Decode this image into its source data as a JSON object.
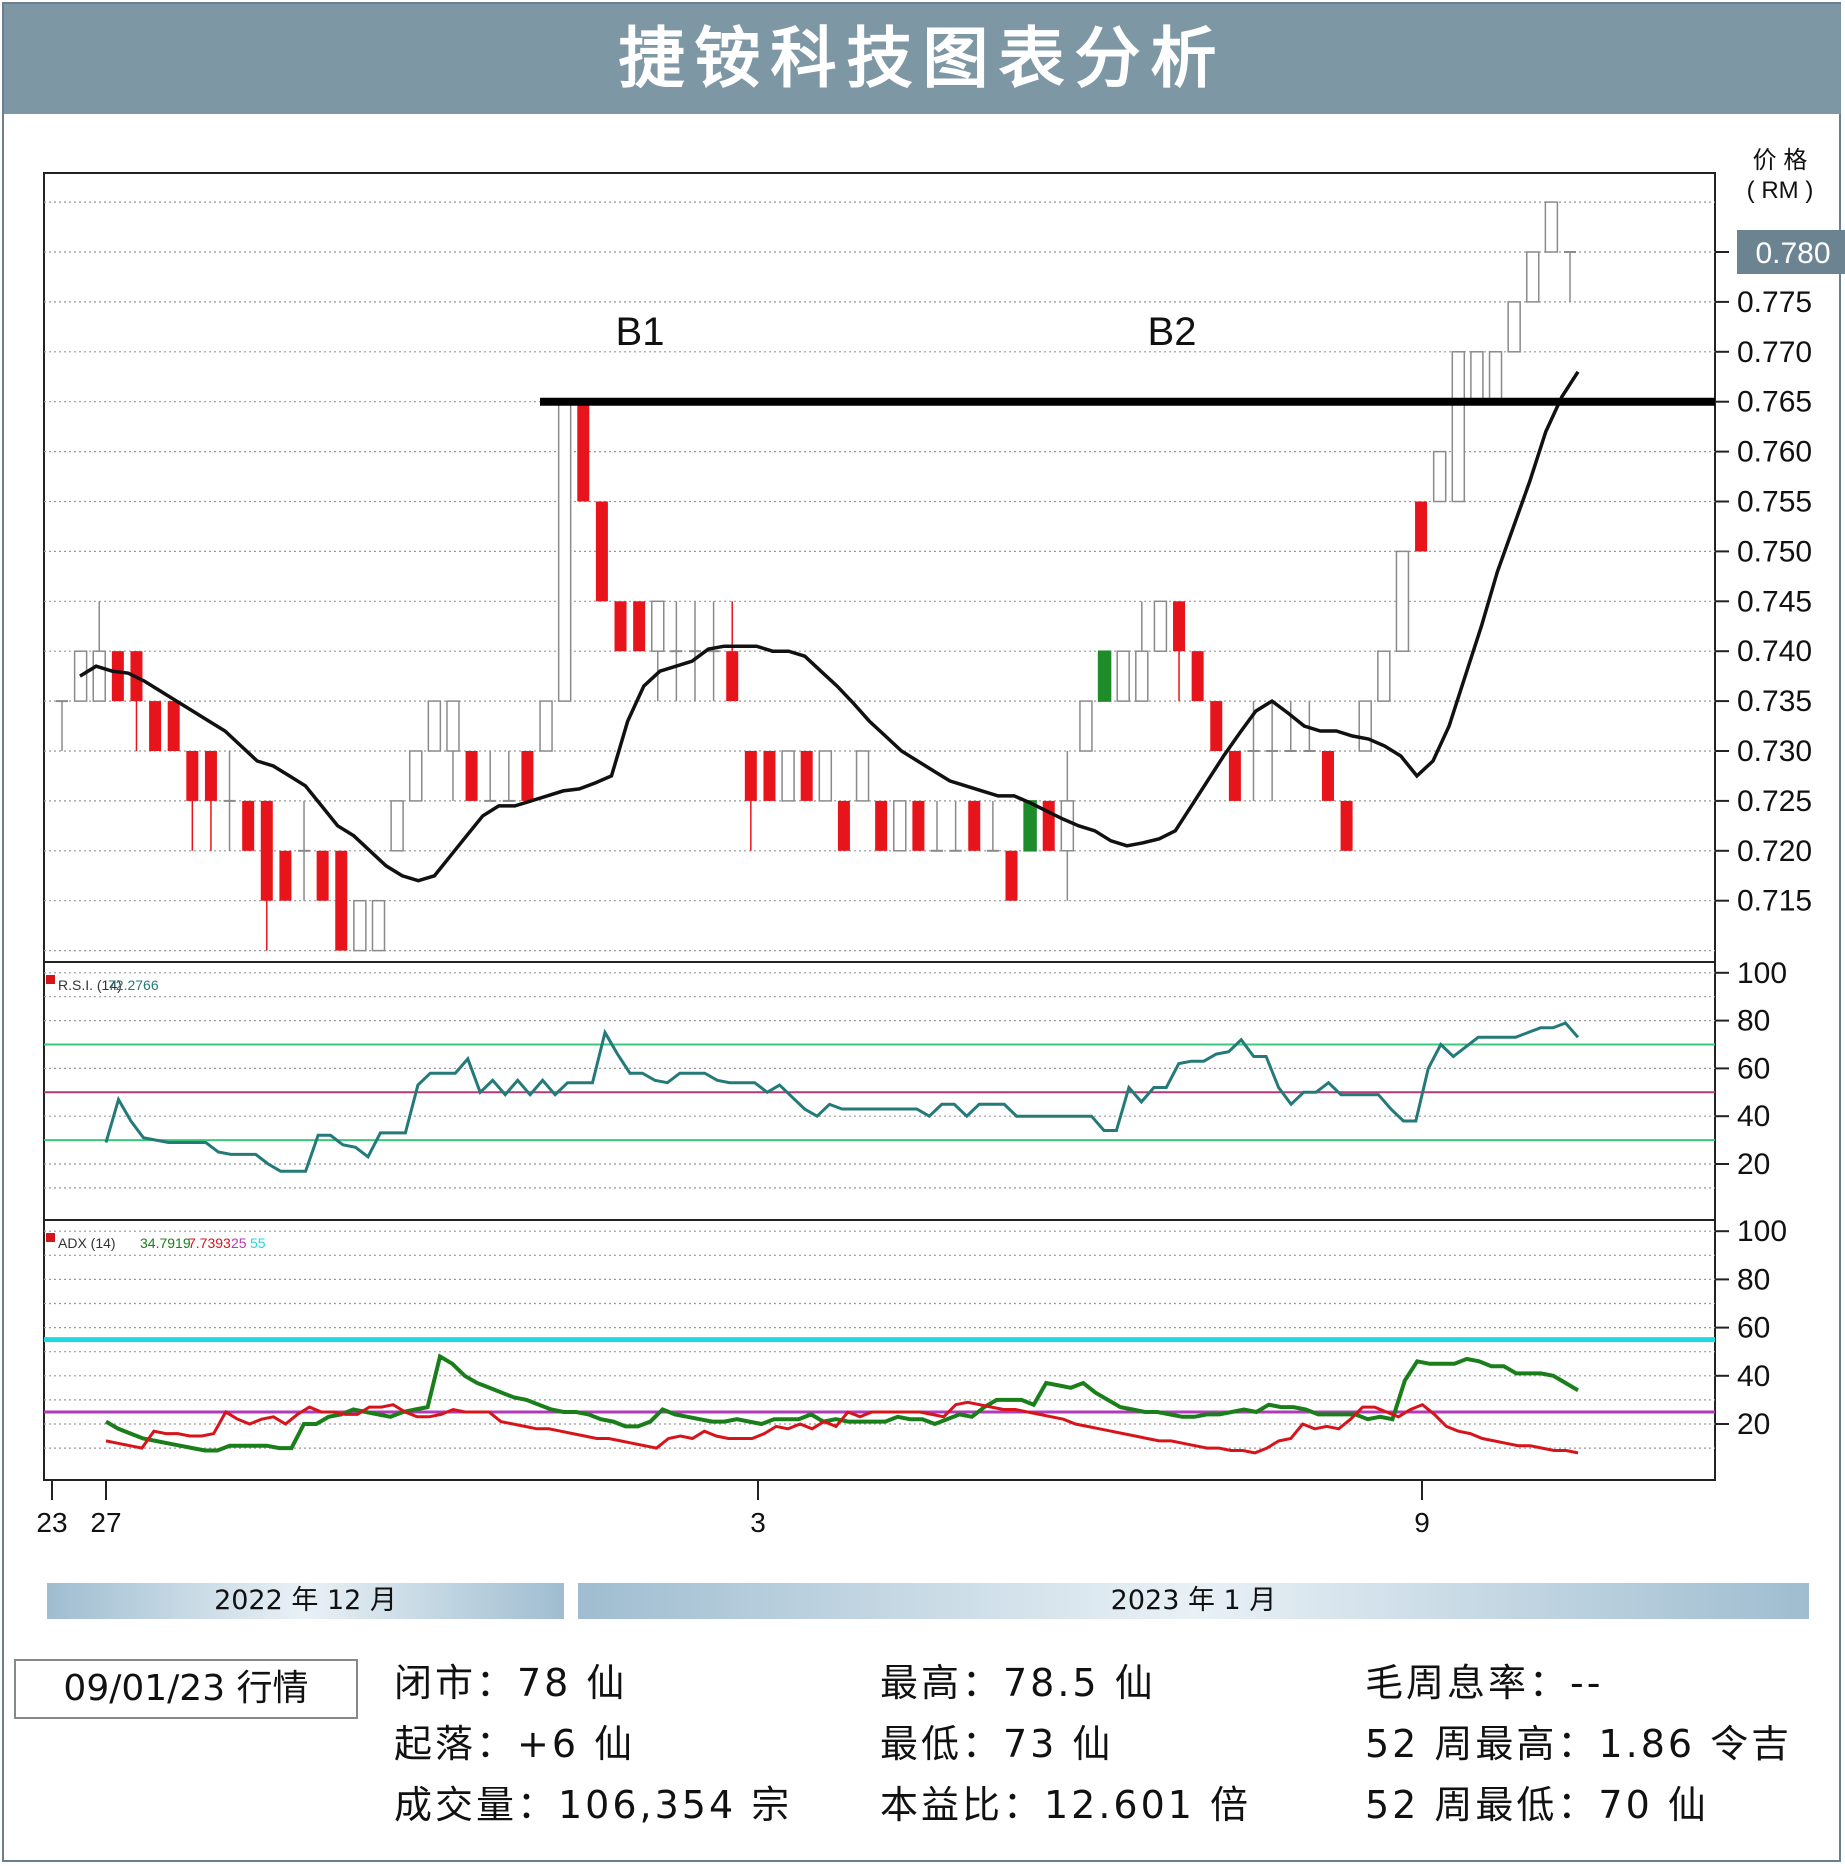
{
  "title": "捷铵科技图表分析",
  "price_axis_label_line1": "价 格",
  "price_axis_label_line2": "( RM )",
  "current_price_badge": "0.780",
  "annotations": {
    "b1": "B1",
    "b2": "B2"
  },
  "rsi_legend": {
    "label": "R.S.I. (14)",
    "value": "72.2766"
  },
  "adx_legend": {
    "label": "ADX (14)",
    "adx": "34.7919",
    "minus_di": "7.7393",
    "level1": "25",
    "level2": "55"
  },
  "x_ticks": [
    "23",
    "27",
    "3",
    "9"
  ],
  "months": {
    "dec": "2022 年 12 月",
    "jan": "2023 年 1 月"
  },
  "date_box": "09/01/23 行情",
  "stats": {
    "close": "闭市：78 仙",
    "change": "起落：+6 仙",
    "volume": "成交量：106,354 宗",
    "high": "最高：78.5 仙",
    "low": "最低：73 仙",
    "pe": "本益比：12.601 倍",
    "dividend_yield": "毛周息率：--",
    "high_52w": "52 周最高：1.86 令吉",
    "low_52w": "52 周最低：70 仙"
  },
  "colors": {
    "up": "#1e8c2a",
    "down": "#e8141b",
    "rsi": "#237a78",
    "adx": "#1a7f1a",
    "minus_di": "#d8141b",
    "cyan": "#22d8e0",
    "magenta": "#b03ab8",
    "green_line": "#3cc87a",
    "badge": "#6c8492"
  },
  "chart_data": [
    {
      "type": "candlestick",
      "ylim": [
        0.71,
        0.79
      ],
      "y_ticks": [
        0.715,
        0.72,
        0.725,
        0.73,
        0.735,
        0.74,
        0.745,
        0.75,
        0.755,
        0.76,
        0.765,
        0.77,
        0.775,
        0.78
      ],
      "resistance": 0.765,
      "candles": [
        {
          "o": 0.735,
          "c": 0.735,
          "h": 0.735,
          "l": 0.73
        },
        {
          "o": 0.735,
          "c": 0.74,
          "h": 0.74,
          "l": 0.735
        },
        {
          "o": 0.735,
          "c": 0.74,
          "h": 0.745,
          "l": 0.735
        },
        {
          "o": 0.74,
          "c": 0.735,
          "h": 0.74,
          "l": 0.735
        },
        {
          "o": 0.74,
          "c": 0.735,
          "h": 0.74,
          "l": 0.73
        },
        {
          "o": 0.735,
          "c": 0.73,
          "h": 0.735,
          "l": 0.73
        },
        {
          "o": 0.735,
          "c": 0.73,
          "h": 0.735,
          "l": 0.73
        },
        {
          "o": 0.73,
          "c": 0.725,
          "h": 0.73,
          "l": 0.72
        },
        {
          "o": 0.73,
          "c": 0.725,
          "h": 0.73,
          "l": 0.72
        },
        {
          "o": 0.725,
          "c": 0.725,
          "h": 0.73,
          "l": 0.72
        },
        {
          "o": 0.725,
          "c": 0.72,
          "h": 0.725,
          "l": 0.72
        },
        {
          "o": 0.725,
          "c": 0.715,
          "h": 0.725,
          "l": 0.71
        },
        {
          "o": 0.72,
          "c": 0.715,
          "h": 0.72,
          "l": 0.715
        },
        {
          "o": 0.72,
          "c": 0.72,
          "h": 0.725,
          "l": 0.715
        },
        {
          "o": 0.72,
          "c": 0.715,
          "h": 0.72,
          "l": 0.715
        },
        {
          "o": 0.72,
          "c": 0.71,
          "h": 0.72,
          "l": 0.71
        },
        {
          "o": 0.71,
          "c": 0.715,
          "h": 0.715,
          "l": 0.71
        },
        {
          "o": 0.71,
          "c": 0.715,
          "h": 0.715,
          "l": 0.71
        },
        {
          "o": 0.72,
          "c": 0.725,
          "h": 0.725,
          "l": 0.72
        },
        {
          "o": 0.725,
          "c": 0.73,
          "h": 0.73,
          "l": 0.725
        },
        {
          "o": 0.73,
          "c": 0.735,
          "h": 0.735,
          "l": 0.73
        },
        {
          "o": 0.73,
          "c": 0.735,
          "h": 0.735,
          "l": 0.725
        },
        {
          "o": 0.73,
          "c": 0.725,
          "h": 0.73,
          "l": 0.725
        },
        {
          "o": 0.725,
          "c": 0.725,
          "h": 0.73,
          "l": 0.725
        },
        {
          "o": 0.725,
          "c": 0.725,
          "h": 0.73,
          "l": 0.725
        },
        {
          "o": 0.73,
          "c": 0.725,
          "h": 0.73,
          "l": 0.725
        },
        {
          "o": 0.73,
          "c": 0.735,
          "h": 0.735,
          "l": 0.73
        },
        {
          "o": 0.735,
          "c": 0.765,
          "h": 0.765,
          "l": 0.735
        },
        {
          "o": 0.765,
          "c": 0.755,
          "h": 0.765,
          "l": 0.755
        },
        {
          "o": 0.755,
          "c": 0.745,
          "h": 0.755,
          "l": 0.745
        },
        {
          "o": 0.745,
          "c": 0.74,
          "h": 0.745,
          "l": 0.74
        },
        {
          "o": 0.745,
          "c": 0.74,
          "h": 0.745,
          "l": 0.74
        },
        {
          "o": 0.74,
          "c": 0.745,
          "h": 0.745,
          "l": 0.735
        },
        {
          "o": 0.74,
          "c": 0.74,
          "h": 0.745,
          "l": 0.735
        },
        {
          "o": 0.74,
          "c": 0.74,
          "h": 0.745,
          "l": 0.735
        },
        {
          "o": 0.74,
          "c": 0.74,
          "h": 0.745,
          "l": 0.735
        },
        {
          "o": 0.74,
          "c": 0.735,
          "h": 0.745,
          "l": 0.735
        },
        {
          "o": 0.73,
          "c": 0.725,
          "h": 0.73,
          "l": 0.72
        },
        {
          "o": 0.73,
          "c": 0.725,
          "h": 0.73,
          "l": 0.725
        },
        {
          "o": 0.725,
          "c": 0.73,
          "h": 0.73,
          "l": 0.725
        },
        {
          "o": 0.73,
          "c": 0.725,
          "h": 0.73,
          "l": 0.725
        },
        {
          "o": 0.725,
          "c": 0.73,
          "h": 0.73,
          "l": 0.725
        },
        {
          "o": 0.725,
          "c": 0.72,
          "h": 0.725,
          "l": 0.72
        },
        {
          "o": 0.725,
          "c": 0.73,
          "h": 0.73,
          "l": 0.725
        },
        {
          "o": 0.725,
          "c": 0.72,
          "h": 0.725,
          "l": 0.72
        },
        {
          "o": 0.72,
          "c": 0.725,
          "h": 0.725,
          "l": 0.72
        },
        {
          "o": 0.725,
          "c": 0.72,
          "h": 0.725,
          "l": 0.72
        },
        {
          "o": 0.72,
          "c": 0.72,
          "h": 0.725,
          "l": 0.72
        },
        {
          "o": 0.72,
          "c": 0.72,
          "h": 0.725,
          "l": 0.72
        },
        {
          "o": 0.725,
          "c": 0.72,
          "h": 0.725,
          "l": 0.72
        },
        {
          "o": 0.72,
          "c": 0.72,
          "h": 0.725,
          "l": 0.72
        },
        {
          "o": 0.72,
          "c": 0.715,
          "h": 0.72,
          "l": 0.715
        },
        {
          "o": 0.72,
          "c": 0.725,
          "h": 0.725,
          "l": 0.72
        },
        {
          "o": 0.725,
          "c": 0.72,
          "h": 0.725,
          "l": 0.72
        },
        {
          "o": 0.72,
          "c": 0.725,
          "h": 0.73,
          "l": 0.715
        },
        {
          "o": 0.73,
          "c": 0.735,
          "h": 0.735,
          "l": 0.73
        },
        {
          "o": 0.735,
          "c": 0.74,
          "h": 0.74,
          "l": 0.735
        },
        {
          "o": 0.735,
          "c": 0.74,
          "h": 0.74,
          "l": 0.735
        },
        {
          "o": 0.735,
          "c": 0.74,
          "h": 0.745,
          "l": 0.735
        },
        {
          "o": 0.74,
          "c": 0.745,
          "h": 0.745,
          "l": 0.74
        },
        {
          "o": 0.745,
          "c": 0.74,
          "h": 0.745,
          "l": 0.735
        },
        {
          "o": 0.74,
          "c": 0.735,
          "h": 0.74,
          "l": 0.735
        },
        {
          "o": 0.735,
          "c": 0.73,
          "h": 0.735,
          "l": 0.73
        },
        {
          "o": 0.73,
          "c": 0.725,
          "h": 0.73,
          "l": 0.725
        },
        {
          "o": 0.73,
          "c": 0.73,
          "h": 0.735,
          "l": 0.725
        },
        {
          "o": 0.73,
          "c": 0.73,
          "h": 0.735,
          "l": 0.725
        },
        {
          "o": 0.73,
          "c": 0.73,
          "h": 0.735,
          "l": 0.73
        },
        {
          "o": 0.73,
          "c": 0.73,
          "h": 0.735,
          "l": 0.73
        },
        {
          "o": 0.73,
          "c": 0.725,
          "h": 0.73,
          "l": 0.725
        },
        {
          "o": 0.725,
          "c": 0.72,
          "h": 0.725,
          "l": 0.72
        },
        {
          "o": 0.73,
          "c": 0.735,
          "h": 0.735,
          "l": 0.73
        },
        {
          "o": 0.735,
          "c": 0.74,
          "h": 0.74,
          "l": 0.735
        },
        {
          "o": 0.74,
          "c": 0.75,
          "h": 0.75,
          "l": 0.74
        },
        {
          "o": 0.755,
          "c": 0.75,
          "h": 0.755,
          "l": 0.75
        },
        {
          "o": 0.755,
          "c": 0.76,
          "h": 0.76,
          "l": 0.755
        },
        {
          "o": 0.755,
          "c": 0.77,
          "h": 0.77,
          "l": 0.755
        },
        {
          "o": 0.765,
          "c": 0.77,
          "h": 0.77,
          "l": 0.765
        },
        {
          "o": 0.765,
          "c": 0.77,
          "h": 0.77,
          "l": 0.765
        },
        {
          "o": 0.77,
          "c": 0.775,
          "h": 0.775,
          "l": 0.77
        },
        {
          "o": 0.775,
          "c": 0.78,
          "h": 0.78,
          "l": 0.775
        },
        {
          "o": 0.78,
          "c": 0.785,
          "h": 0.785,
          "l": 0.78
        },
        {
          "o": 0.78,
          "c": 0.78,
          "h": 0.78,
          "l": 0.775
        }
      ],
      "ma": [
        0.7375,
        0.7385,
        0.738,
        0.7378,
        0.737,
        0.736,
        0.735,
        0.734,
        0.733,
        0.732,
        0.7305,
        0.729,
        0.7285,
        0.7275,
        0.7265,
        0.7245,
        0.7225,
        0.7215,
        0.72,
        0.7185,
        0.7175,
        0.717,
        0.7175,
        0.7195,
        0.7215,
        0.7235,
        0.7245,
        0.7245,
        0.725,
        0.7255,
        0.726,
        0.7262,
        0.7268,
        0.7275,
        0.733,
        0.7365,
        0.738,
        0.7385,
        0.739,
        0.7402,
        0.7405,
        0.7405,
        0.7405,
        0.74,
        0.74,
        0.7395,
        0.738,
        0.7365,
        0.7348,
        0.733,
        0.7315,
        0.73,
        0.729,
        0.728,
        0.727,
        0.7265,
        0.726,
        0.7255,
        0.7255,
        0.7248,
        0.724,
        0.7232,
        0.7225,
        0.722,
        0.721,
        0.7205,
        0.7208,
        0.7212,
        0.722,
        0.7245,
        0.727,
        0.7295,
        0.7318,
        0.734,
        0.735,
        0.7338,
        0.7325,
        0.732,
        0.732,
        0.7315,
        0.7312,
        0.7305,
        0.7295,
        0.7275,
        0.729,
        0.7325,
        0.7375,
        0.7425,
        0.748,
        0.7525,
        0.757,
        0.762,
        0.7655,
        0.768
      ]
    },
    {
      "type": "line",
      "name": "R.S.I. (14)",
      "ylim": [
        0,
        100
      ],
      "y_ticks": [
        20,
        40,
        60,
        80,
        100
      ],
      "levels": [
        30,
        50,
        70
      ],
      "values": [
        29,
        47,
        38,
        31,
        30,
        29,
        29,
        29,
        29,
        25,
        24,
        24,
        24,
        20,
        17,
        17,
        17,
        32,
        32,
        28,
        27,
        23,
        33,
        33,
        33,
        53,
        58,
        58,
        58,
        64,
        50,
        55,
        49,
        55,
        49,
        55,
        49,
        54,
        54,
        54,
        75,
        66,
        58,
        58,
        55,
        54,
        58,
        58,
        58,
        55,
        54,
        54,
        54,
        50,
        53,
        48,
        43,
        40,
        45,
        43,
        43,
        43,
        43,
        43,
        43,
        43,
        40,
        45,
        45,
        40,
        45,
        45,
        45,
        40,
        40,
        40,
        40,
        40,
        40,
        40,
        34,
        34,
        52,
        46,
        52,
        52,
        62,
        63,
        63,
        66,
        67,
        72,
        65,
        65,
        52,
        45,
        50,
        50,
        54,
        49,
        49,
        49,
        49,
        43,
        38,
        38,
        60,
        70,
        65,
        69,
        73,
        73,
        73,
        73,
        75,
        77,
        77,
        79,
        73
      ]
    },
    {
      "type": "line",
      "name": "ADX (14)",
      "ylim": [
        0,
        100
      ],
      "y_ticks": [
        20,
        40,
        60,
        80,
        100
      ],
      "levels": [
        25,
        55
      ],
      "series": [
        {
          "name": "34.7919",
          "values": [
            21,
            18,
            16,
            14,
            13,
            12,
            11,
            10,
            9,
            9,
            11,
            11,
            11,
            11,
            10,
            10,
            20,
            20,
            23,
            24,
            26,
            25,
            24,
            23,
            25,
            26,
            27,
            48,
            45,
            40,
            37,
            35,
            33,
            31,
            30,
            28,
            26,
            25,
            25,
            24,
            22,
            21,
            19,
            19,
            21,
            26,
            24,
            23,
            22,
            21,
            21,
            22,
            21,
            20,
            22,
            22,
            22,
            24,
            21,
            22,
            21,
            21,
            21,
            21,
            23,
            22,
            22,
            20,
            22,
            24,
            23,
            27,
            30,
            30,
            30,
            28,
            37,
            36,
            35,
            37,
            33,
            30,
            27,
            26,
            25,
            25,
            24,
            23,
            23,
            24,
            24,
            25,
            26,
            25,
            28,
            27,
            27,
            26,
            24,
            24,
            24,
            24,
            22,
            23,
            22,
            38,
            46,
            45,
            45,
            45,
            47,
            46,
            44,
            44,
            41,
            41,
            41,
            40,
            37,
            34
          ]
        },
        {
          "name": "7.7393",
          "values": [
            13,
            12,
            11,
            10,
            17,
            16,
            16,
            15,
            15,
            16,
            25,
            22,
            20,
            22,
            23,
            20,
            24,
            27,
            25,
            25,
            24,
            24,
            27,
            27,
            28,
            25,
            23,
            23,
            24,
            26,
            25,
            25,
            25,
            21,
            20,
            19,
            18,
            18,
            17,
            16,
            15,
            14,
            14,
            13,
            12,
            11,
            10,
            14,
            15,
            14,
            17,
            15,
            14,
            14,
            14,
            16,
            19,
            18,
            20,
            18,
            21,
            19,
            25,
            23,
            25,
            25,
            25,
            25,
            25,
            24,
            23,
            28,
            29,
            28,
            27,
            26,
            26,
            25,
            24,
            23,
            22,
            20,
            19,
            18,
            17,
            16,
            15,
            14,
            13,
            13,
            12,
            11,
            10,
            10,
            9,
            9,
            8,
            10,
            13,
            14,
            20,
            18,
            19,
            18,
            22,
            27,
            27,
            25,
            23,
            26,
            28,
            24,
            19,
            17,
            16,
            14,
            13,
            12,
            11,
            11,
            10,
            9,
            9,
            8
          ]
        }
      ]
    }
  ]
}
